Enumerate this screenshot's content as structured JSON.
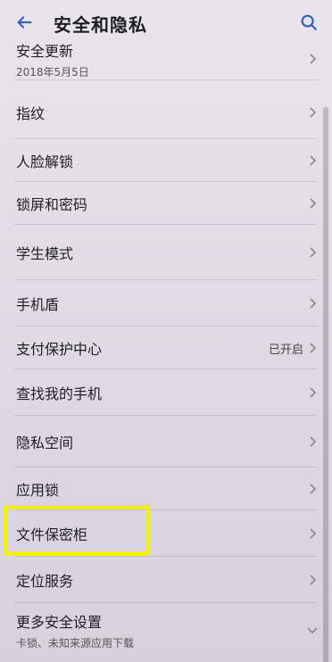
{
  "header": {
    "title": "安全和隐私"
  },
  "items": [
    {
      "label": "安全更新",
      "sub": "2018年5月5日"
    },
    {
      "label": "指纹"
    },
    {
      "label": "人脸解锁"
    },
    {
      "label": "锁屏和密码"
    },
    {
      "label": "学生模式"
    },
    {
      "label": "手机盾"
    },
    {
      "label": "支付保护中心",
      "value": "已开启"
    },
    {
      "label": "查找我的手机"
    },
    {
      "label": "隐私空间"
    },
    {
      "label": "应用锁"
    },
    {
      "label": "文件保密柜"
    },
    {
      "label": "定位服务"
    },
    {
      "label": "更多安全设置",
      "sub": "卡锁、未知来源应用下载"
    }
  ],
  "colors": {
    "accent": "#3a62b8",
    "highlight": "#f2f200"
  }
}
